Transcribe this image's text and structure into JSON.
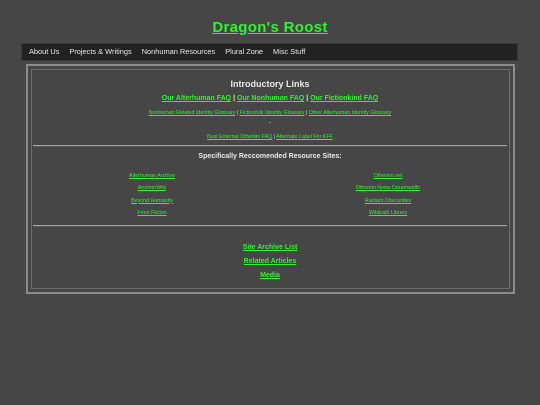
{
  "site": {
    "title": "Dragon's Roost"
  },
  "nav": {
    "items": [
      {
        "label": "About Us"
      },
      {
        "label": "Projects & Writings"
      },
      {
        "label": "Nonhuman Resources"
      },
      {
        "label": "Plural Zone"
      },
      {
        "label": "Misc Stuff"
      }
    ]
  },
  "intro": {
    "heading": "Introductory Links",
    "faqs": [
      {
        "label": "Our Alterhuman FAQ"
      },
      {
        "label": "Our Nonhuman FAQ"
      },
      {
        "label": "Our Fictionkind FAQ"
      }
    ],
    "separator": "|",
    "glossaries": [
      {
        "label": "Nonhuman Related Identity Glossary"
      },
      {
        "label": "Fictionfolk Identity Glossary"
      },
      {
        "label": "Other Alterhuman Identity Glossary"
      }
    ],
    "dash": "-",
    "external": [
      {
        "label": "Best External Otherkin FAQ"
      },
      {
        "label": "Alternate Label For KFF"
      }
    ]
  },
  "resources": {
    "heading": "Specifically Reccomended Resource Sites:",
    "left": [
      {
        "label": "Alterhuman Archive"
      },
      {
        "label": "AnotherWiki"
      },
      {
        "label": "Beyond Humanity"
      },
      {
        "label": "From Fiction"
      }
    ],
    "right": [
      {
        "label": "Otherkin.net"
      },
      {
        "label": "Otherkin News Dreamwidth"
      },
      {
        "label": "Radiant Obscurities"
      },
      {
        "label": "Wildpath Library"
      }
    ]
  },
  "bottom": {
    "links": [
      {
        "label": "Site Archive List"
      },
      {
        "label": "Related Articles"
      },
      {
        "label": "Media"
      }
    ]
  },
  "colors": {
    "background": "#464646",
    "link": "#2cf52c",
    "navbar": "#222222",
    "text": "#e9e9e9"
  }
}
